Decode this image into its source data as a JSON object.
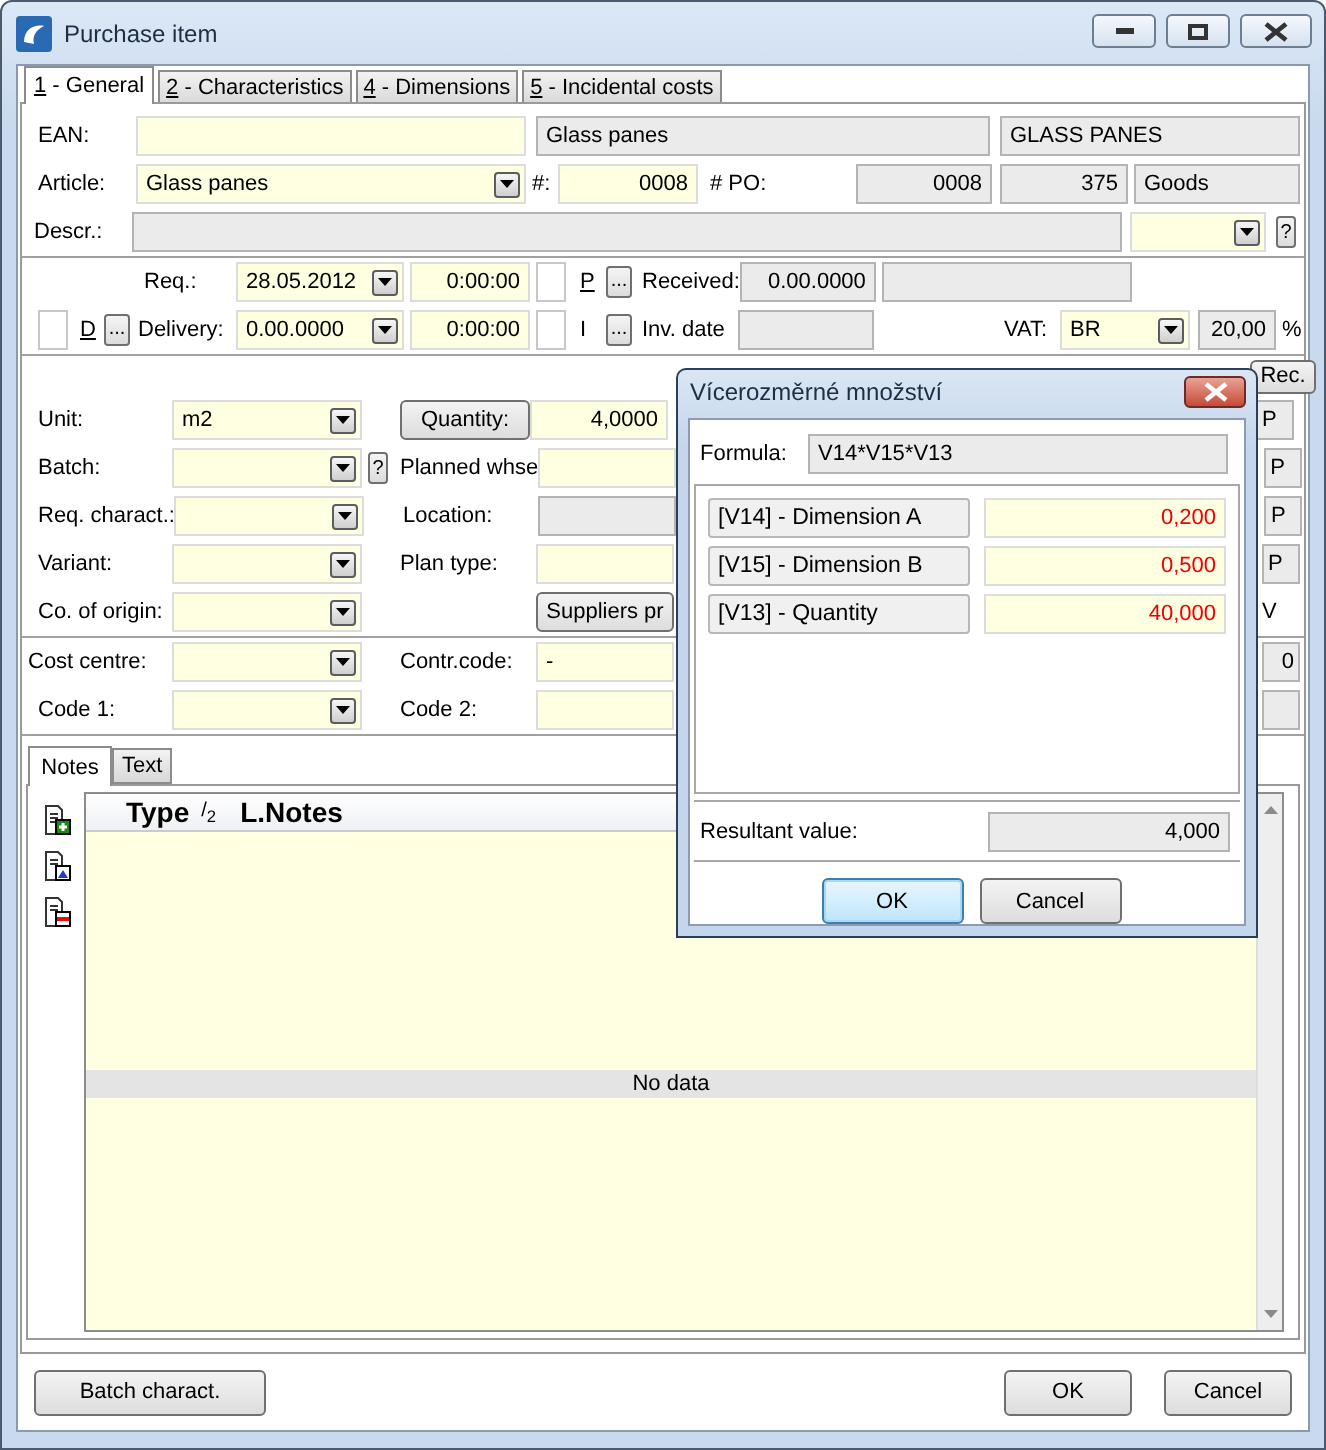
{
  "window": {
    "title": "Purchase item"
  },
  "tabs": [
    {
      "label": "1 - General",
      "selected": true
    },
    {
      "label": "2 - Characteristics",
      "selected": false
    },
    {
      "label": "4 - Dimensions",
      "selected": false
    },
    {
      "label": "5 - Incidental costs",
      "selected": false
    }
  ],
  "ean": {
    "label": "EAN:",
    "name": "Glass panes",
    "code": "GLASS PANES"
  },
  "article": {
    "label": "Article:",
    "value": "Glass panes",
    "number_label": "#:",
    "number": "0008",
    "po_label": "# PO:",
    "po_number": "0008",
    "po_line": "375",
    "type": "Goods"
  },
  "description": {
    "label": "Descr.:",
    "help": "?"
  },
  "requested": {
    "label": "Req.:",
    "date": "28.05.2012",
    "time": "0:00:00",
    "checked": false,
    "flag": "P",
    "more": "...",
    "received_label": "Received:",
    "received": "0.00.0000"
  },
  "delivery": {
    "checked": false,
    "flag": "D",
    "more": "...",
    "label": "Delivery:",
    "date": "0.00.0000",
    "time": "0:00:00",
    "invoice_checked": false,
    "invoice_flag": "I",
    "invoice_more": "...",
    "invoice_label": "Inv. date",
    "vat_label": "VAT:",
    "vat": "BR",
    "vat_rate": "20,00",
    "percent": "%"
  },
  "rec_button": "Rec.",
  "item_rows": [
    {
      "label": "Unit:",
      "value": "m2",
      "middle": {
        "kind": "button",
        "text": "Quantity:"
      },
      "field": {
        "kind": "input",
        "value": "4,0000",
        "readonly": false
      },
      "edge": {
        "text": "P",
        "boxed": true
      }
    },
    {
      "label": "Batch:",
      "help": "?",
      "middle": {
        "kind": "label",
        "text": "Planned whse"
      },
      "field": {
        "kind": "input",
        "readonly": false
      },
      "edge": {
        "text": "P",
        "boxed": true
      }
    },
    {
      "label": "Req. charact.:",
      "middle": {
        "kind": "label",
        "text": "Location:"
      },
      "field": {
        "kind": "input",
        "readonly": true
      },
      "edge": {
        "text": "P",
        "boxed": true
      }
    },
    {
      "label": "Variant:",
      "middle": {
        "kind": "label",
        "text": "Plan type:"
      },
      "field": {
        "kind": "input",
        "readonly": false
      },
      "edge": {
        "text": "P",
        "boxed": true
      }
    },
    {
      "label": "Co. of origin:",
      "field": {
        "kind": "button",
        "value": "Suppliers pr"
      },
      "edge": {
        "text": "V",
        "boxed": false
      }
    }
  ],
  "code_rows": [
    {
      "label": "Cost centre:",
      "middle": {
        "kind": "label",
        "text": "Contr.code:"
      },
      "field": {
        "kind": "input",
        "value": "-",
        "readonly": false
      },
      "edge": {
        "text": "0",
        "boxed": true
      }
    },
    {
      "label": "Code 1:",
      "middle": {
        "kind": "label",
        "text": "Code 2:"
      },
      "field": {
        "kind": "input",
        "readonly": false
      },
      "edge": {
        "boxed": true
      }
    }
  ],
  "notes_tabs": [
    {
      "label": "Notes",
      "selected": true
    },
    {
      "label": "Text",
      "selected": false
    }
  ],
  "notes_table": {
    "columns": [
      "Type",
      "/$_{2}$",
      "L.",
      "Notes"
    ],
    "empty_text": "No data"
  },
  "footer": {
    "left_buttons": [
      "Batch charact."
    ],
    "right_buttons": [
      "OK",
      "Cancel"
    ]
  },
  "dialog": {
    "title": "Vícerozměrné množství",
    "formula_label": "Formula:",
    "formula": "V14*V15*V13",
    "variables": [
      {
        "label": "[V14] - Dimension A",
        "value": "0,200"
      },
      {
        "label": "[V15] - Dimension B",
        "value": "0,500"
      },
      {
        "label": "[V13] - Quantity",
        "value": "40,000"
      }
    ],
    "result_label": "Resultant value:",
    "result": "4,000",
    "buttons": [
      {
        "label": "OK",
        "focused": true
      },
      {
        "label": "Cancel",
        "focused": false
      }
    ]
  }
}
